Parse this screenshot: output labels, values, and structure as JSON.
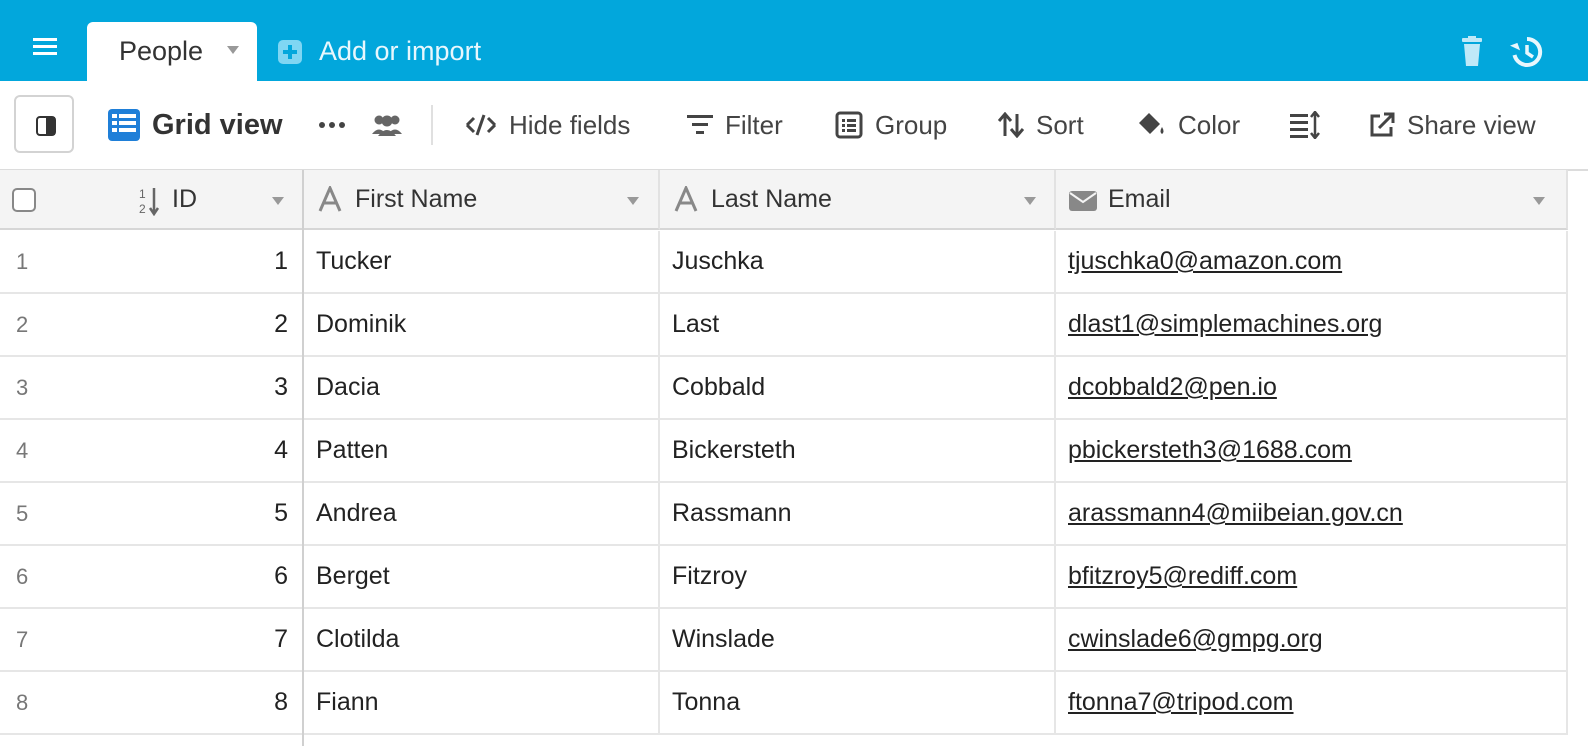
{
  "header": {
    "table_tab": "People",
    "add_import": "Add or import"
  },
  "toolbar": {
    "view_name": "Grid view",
    "hide_fields": "Hide fields",
    "filter": "Filter",
    "group": "Group",
    "sort": "Sort",
    "color": "Color",
    "share_view": "Share view"
  },
  "columns": [
    {
      "label": "ID",
      "type": "number"
    },
    {
      "label": "First Name",
      "type": "text"
    },
    {
      "label": "Last Name",
      "type": "text"
    },
    {
      "label": "Email",
      "type": "email"
    }
  ],
  "rows": [
    {
      "num": "1",
      "id": "1",
      "first": "Tucker",
      "last": "Juschka",
      "email": "tjuschka0@amazon.com"
    },
    {
      "num": "2",
      "id": "2",
      "first": "Dominik",
      "last": "Last",
      "email": "dlast1@simplemachines.org"
    },
    {
      "num": "3",
      "id": "3",
      "first": "Dacia",
      "last": "Cobbald",
      "email": "dcobbald2@pen.io"
    },
    {
      "num": "4",
      "id": "4",
      "first": "Patten",
      "last": "Bickersteth",
      "email": "pbickersteth3@1688.com"
    },
    {
      "num": "5",
      "id": "5",
      "first": "Andrea",
      "last": "Rassmann",
      "email": "arassmann4@miibeian.gov.cn"
    },
    {
      "num": "6",
      "id": "6",
      "first": "Berget",
      "last": "Fitzroy",
      "email": "bfitzroy5@rediff.com"
    },
    {
      "num": "7",
      "id": "7",
      "first": "Clotilda",
      "last": "Winslade",
      "email": "cwinslade6@gmpg.org"
    },
    {
      "num": "8",
      "id": "8",
      "first": "Fiann",
      "last": "Tonna",
      "email": "ftonna7@tripod.com"
    }
  ],
  "colors": {
    "topbar": "#02a7dc",
    "grid_icon": "#1f7fd8"
  }
}
